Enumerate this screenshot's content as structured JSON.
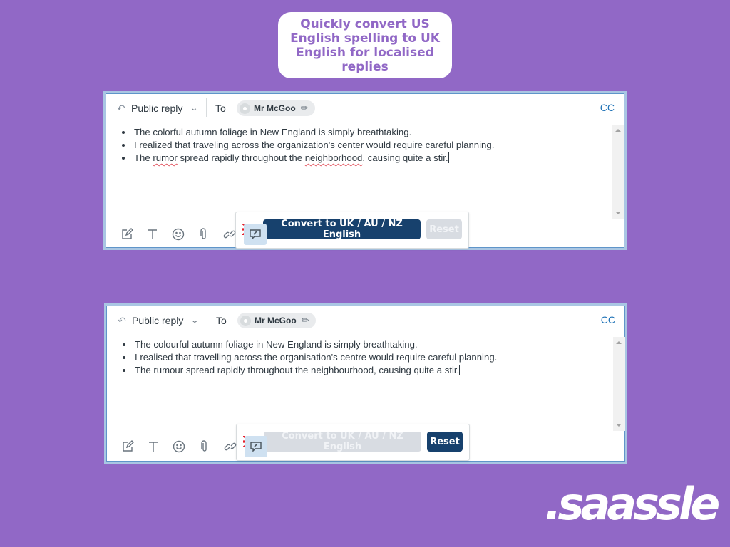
{
  "caption": {
    "text": "Quickly convert US English spelling to UK English for localised replies"
  },
  "brand": {
    "logo_text": ".saassle",
    "background_color": "#9168c6",
    "primary_button_color": "#17416d"
  },
  "panels": [
    {
      "state": "before",
      "header": {
        "reply_type": "Public reply",
        "to_label": "To",
        "recipient": "Mr McGoo",
        "cc_label": "CC"
      },
      "bullets": [
        {
          "parts": [
            "The colorful autumn foliage in New England is simply breathtaking."
          ]
        },
        {
          "parts": [
            "I realized that traveling across the organization's center would require careful planning."
          ]
        },
        {
          "parts": [
            "The ",
            "rumor",
            " spread rapidly throughout the ",
            "neighborhood",
            ", causing quite a stir."
          ]
        }
      ],
      "spellcheck_flagged": [
        "rumor",
        "neighborhood"
      ],
      "convert_button": {
        "label": "Convert to UK / AU / NZ English",
        "enabled": true
      },
      "reset_button": {
        "label": "Reset",
        "enabled": false
      }
    },
    {
      "state": "after",
      "header": {
        "reply_type": "Public reply",
        "to_label": "To",
        "recipient": "Mr McGoo",
        "cc_label": "CC"
      },
      "bullets": [
        {
          "parts": [
            "The colourful autumn foliage in New England is simply breathtaking."
          ]
        },
        {
          "parts": [
            "I realised that travelling across the organisation's centre would require careful planning."
          ]
        },
        {
          "parts": [
            "The rumour spread rapidly throughout the neighbourhood, causing quite a stir."
          ]
        }
      ],
      "spellcheck_flagged": [],
      "convert_button": {
        "label": "Convert to UK / AU / NZ English",
        "enabled": false
      },
      "reset_button": {
        "label": "Reset",
        "enabled": true
      }
    }
  ],
  "toolbar_icons": [
    "compose-icon",
    "text-format-icon",
    "emoji-icon",
    "attachment-icon",
    "link-icon",
    "comment-icon"
  ]
}
